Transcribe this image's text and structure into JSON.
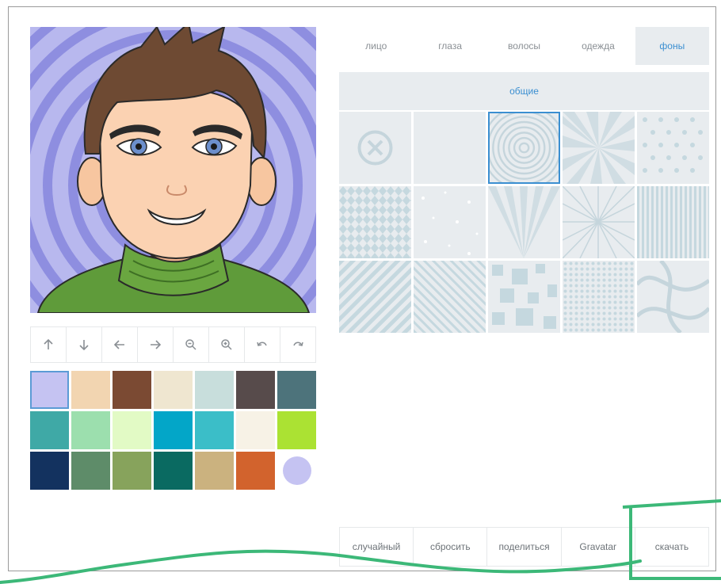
{
  "tabs": [
    {
      "label": "лицо"
    },
    {
      "label": "глаза"
    },
    {
      "label": "волосы"
    },
    {
      "label": "одежда"
    },
    {
      "label": "фоны",
      "active": true
    }
  ],
  "subtab": {
    "label": "общие"
  },
  "tools": [
    {
      "icon": "arrow-up-icon"
    },
    {
      "icon": "arrow-down-icon"
    },
    {
      "icon": "arrow-left-icon"
    },
    {
      "icon": "arrow-right-icon"
    },
    {
      "icon": "zoom-out-icon"
    },
    {
      "icon": "zoom-in-icon"
    },
    {
      "icon": "undo-icon"
    },
    {
      "icon": "redo-icon"
    }
  ],
  "palette": [
    "#c5c3f2",
    "#f2d5b1",
    "#7b4a33",
    "#efe6d0",
    "#c8dedc",
    "#574b4b",
    "#4d737b",
    "#3fa9a6",
    "#9cdfae",
    "#e2fac5",
    "#03a6c8",
    "#3bbec8",
    "#f7f2e6",
    "#abe233",
    "#13325f",
    "#5e8c69",
    "#87a35c",
    "#0a6a61",
    "#cbb27f",
    "#d2632d",
    "#c5c3f2"
  ],
  "palette_selected_index": 0,
  "backgrounds": [
    "none",
    "blank",
    "concentric-circles",
    "sunburst",
    "hearts",
    "diamonds",
    "dots-scatter",
    "rays-fan",
    "starburst",
    "vertical-stripes",
    "diagonal-stripes",
    "diagonal-stripes-thin",
    "squares-pixel",
    "dot-grid",
    "curves"
  ],
  "background_selected_index": 2,
  "actions": [
    {
      "label": "случайный"
    },
    {
      "label": "сбросить"
    },
    {
      "label": "поделиться"
    },
    {
      "label": "Gravatar"
    },
    {
      "label": "скачать"
    }
  ],
  "colors": {
    "accent": "#3b8fd1",
    "tab_bg": "#e8ecef",
    "annotation": "#3cb878",
    "avatar_bg": "#b8b8ee",
    "avatar_rings": "#8e8ee0"
  }
}
